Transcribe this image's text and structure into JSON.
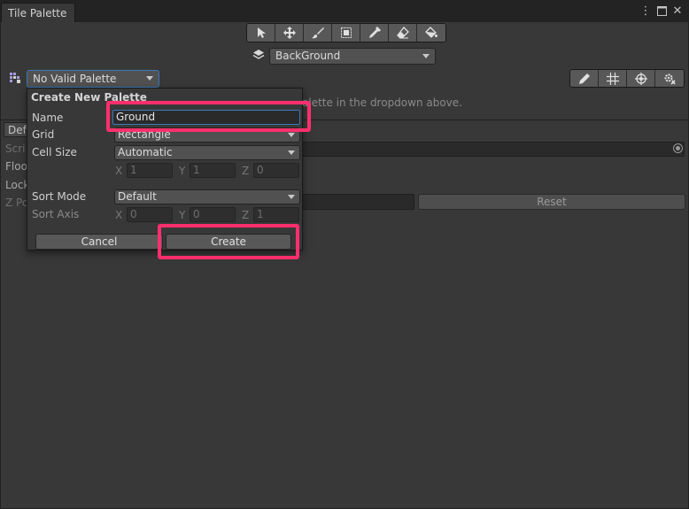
{
  "window": {
    "tab_title": "Tile Palette"
  },
  "window_icons": [
    "more-vert-icon",
    "maximize-icon",
    "close-icon"
  ],
  "toolbar": {
    "tools": [
      "select-icon",
      "move-icon",
      "paint-brush-icon",
      "box-fill-icon",
      "picker-icon",
      "eraser-icon",
      "fill-bucket-icon"
    ]
  },
  "layer": {
    "selected": "BackGround"
  },
  "palette": {
    "selected": "No Valid Palette"
  },
  "info": {
    "message": "alette in the dropdown above."
  },
  "background_panel": {
    "tab_label": "Def",
    "rows": [
      "Scri",
      "Floo",
      "Lock",
      "Z Po"
    ],
    "reset_label": "Reset"
  },
  "create_palette": {
    "title": "Create New Palette",
    "name_label": "Name",
    "name_value": "Ground",
    "grid_label": "Grid",
    "grid_value": "Rectangle",
    "cell_size_label": "Cell Size",
    "cell_size_value": "Automatic",
    "cell_x": "1",
    "cell_y": "1",
    "cell_z": "0",
    "sort_mode_label": "Sort Mode",
    "sort_mode_value": "Default",
    "sort_axis_label": "Sort Axis",
    "axis_x": "0",
    "axis_y": "0",
    "axis_z": "1",
    "x_letter": "X",
    "y_letter": "Y",
    "z_letter": "Z",
    "cancel_label": "Cancel",
    "create_label": "Create"
  },
  "highlight_color": "#ff2f6d"
}
